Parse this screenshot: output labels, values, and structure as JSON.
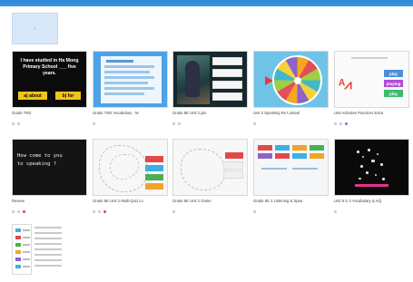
{
  "app": {
    "accent": "#2e86d8"
  },
  "folder": {
    "icon": "folder-dot"
  },
  "cards": [
    {
      "title": "Grade 7W2",
      "sub": "",
      "quiz_text": "I have studied in Ha Mong Primary School ___ five years.",
      "btn_a": "a) about",
      "btn_b": "b) for"
    },
    {
      "title": "Grade 7W2 Vocabulary - M",
      "sub": ""
    },
    {
      "title": "Grade 8E Unit 2 pla",
      "sub": ""
    },
    {
      "title": "Unit 2 Speaking Re Loisivel",
      "sub": ""
    },
    {
      "title": "Unit Activities Practices Extra",
      "sub": "",
      "tag_1": "play",
      "tag_2": "playing",
      "tag_3": "play"
    },
    {
      "title": "Review",
      "sub": "",
      "chalk_1": "How come to you",
      "chalk_2": "to speaking ?"
    },
    {
      "title": "Grade 8E Unit 2 Multi-Quiz Lo",
      "sub": ""
    },
    {
      "title": "Grade 8E Unit 2 Game",
      "sub": ""
    },
    {
      "title": "Grade 8E 2 Listening & Spea",
      "sub": ""
    },
    {
      "title": "Unit 8 G 2 Vocabulary & Adj",
      "sub": ""
    }
  ]
}
